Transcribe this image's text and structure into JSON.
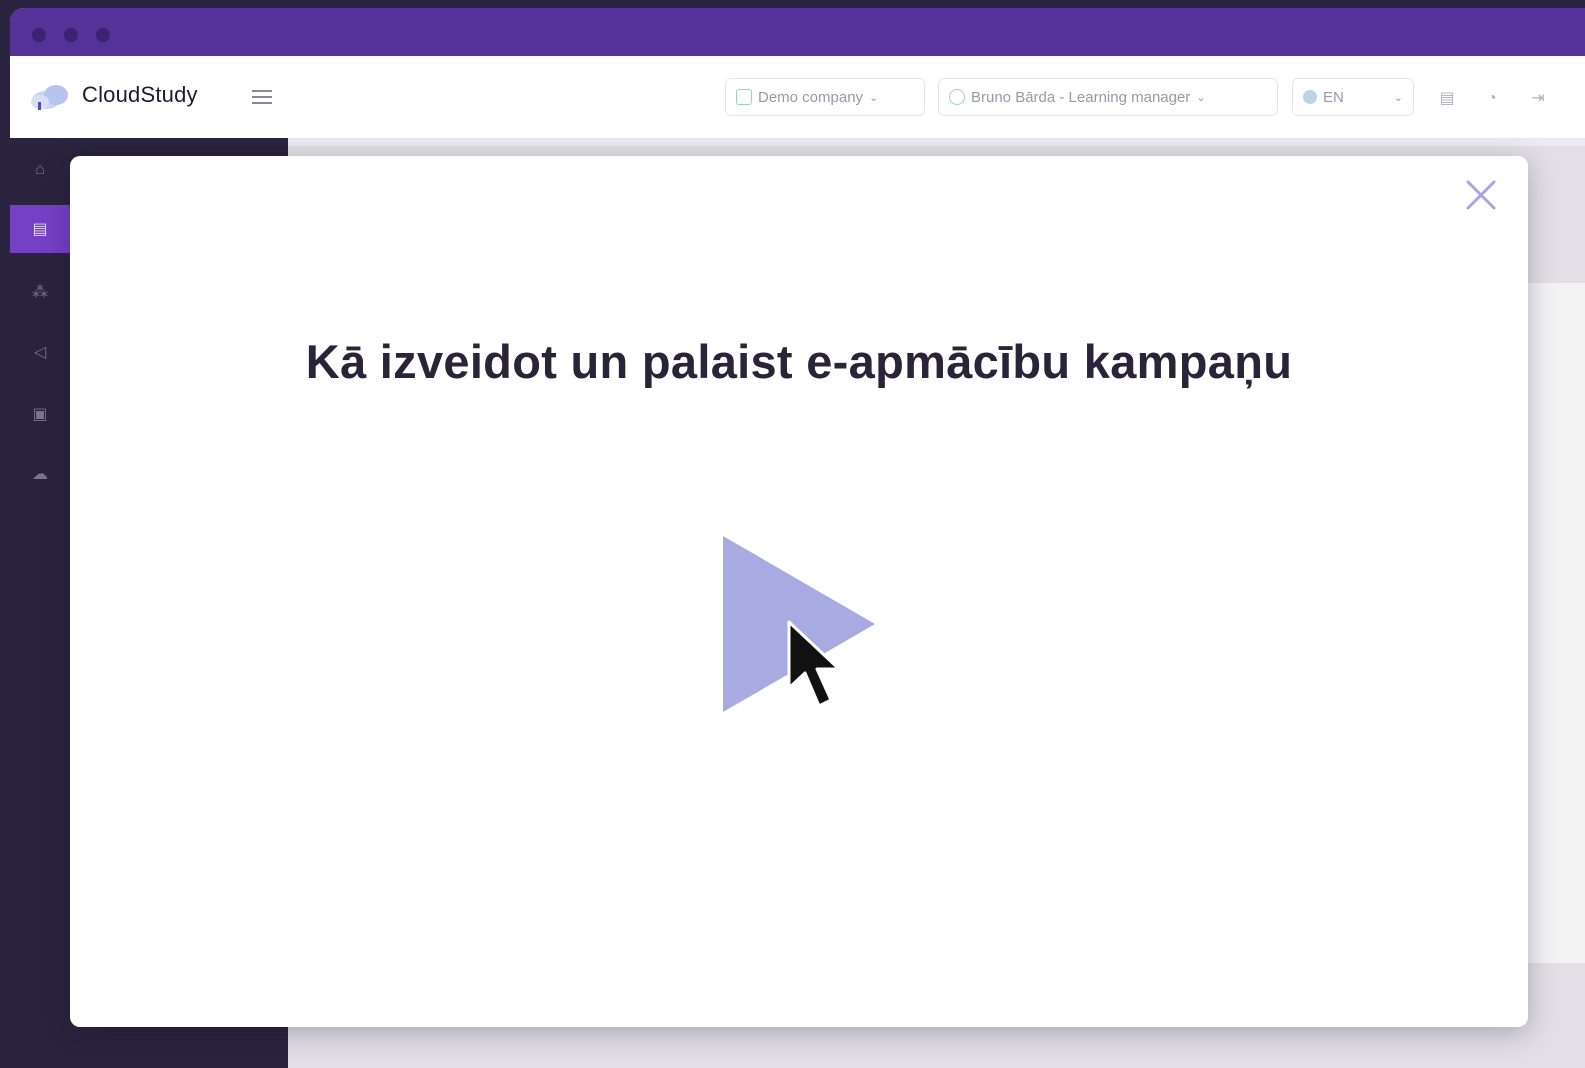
{
  "app": {
    "name": "CloudStudy"
  },
  "header": {
    "company": {
      "label": "Demo company"
    },
    "user": {
      "label": "Bruno Bārda - Learning manager"
    },
    "language": {
      "label": "EN"
    }
  },
  "sidebar": {
    "items": [
      {
        "icon": "home-icon"
      },
      {
        "icon": "document-icon",
        "active": true
      },
      {
        "icon": "users-icon"
      },
      {
        "icon": "megaphone-icon"
      },
      {
        "icon": "briefcase-icon"
      },
      {
        "icon": "cloud-icon"
      }
    ]
  },
  "modal": {
    "title": "Kā izveidot un palaist e-apmācību kampaņu",
    "play_icon": "play-icon",
    "close_icon": "close-icon"
  },
  "colors": {
    "titlebar": "#55319a",
    "sidebar": "#2b2440",
    "accent": "#7b43cf",
    "play": "#a8abe2"
  }
}
